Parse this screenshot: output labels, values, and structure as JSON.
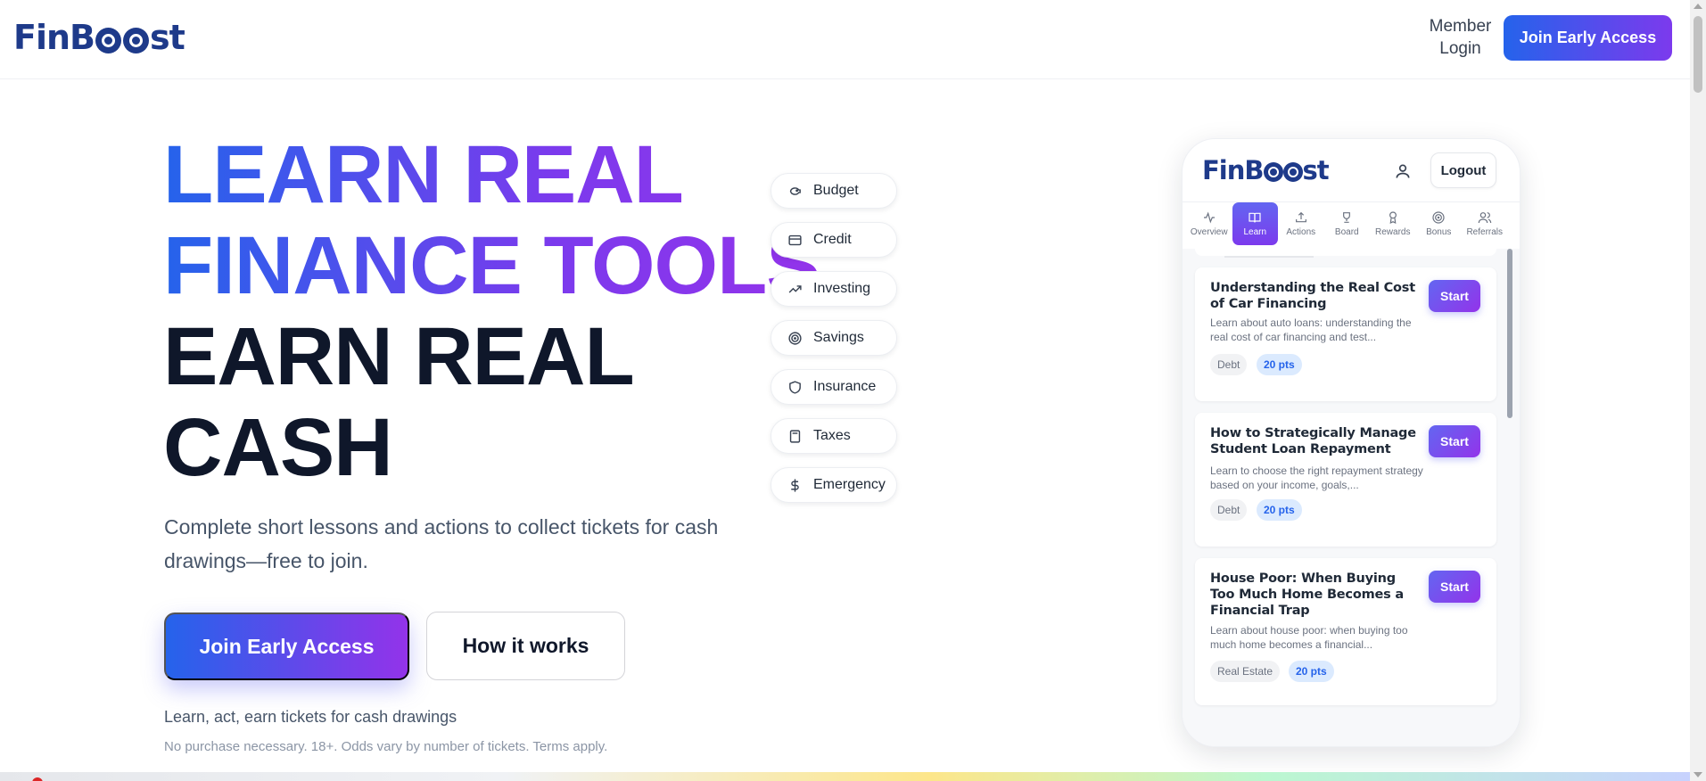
{
  "header": {
    "logo_text": "FinBoost",
    "member_login": "Member Login",
    "cta": "Join Early Access"
  },
  "hero": {
    "line1": "LEARN REAL",
    "line2": "FINANCE TOOLS",
    "line3": "EARN REAL",
    "line4": "CASH",
    "subtitle": "Complete short lessons and actions to collect tickets for cash drawings—free to join.",
    "primary_button": "Join Early Access",
    "secondary_button": "How it works",
    "note": "Learn, act, earn tickets for cash drawings",
    "fine_print": "No purchase necessary. 18+. Odds vary by number of tickets. Terms apply."
  },
  "categories": [
    {
      "label": "Budget",
      "icon": "piggy-bank-icon"
    },
    {
      "label": "Credit",
      "icon": "credit-card-icon"
    },
    {
      "label": "Investing",
      "icon": "trending-up-icon"
    },
    {
      "label": "Savings",
      "icon": "target-icon"
    },
    {
      "label": "Insurance",
      "icon": "shield-icon"
    },
    {
      "label": "Taxes",
      "icon": "calculator-icon"
    },
    {
      "label": "Emergency",
      "icon": "dollar-icon"
    }
  ],
  "phone": {
    "logo_text": "FinBoost",
    "logout": "Logout",
    "tabs": [
      {
        "label": "Overview",
        "icon": "activity-icon"
      },
      {
        "label": "Learn",
        "icon": "book-icon",
        "active": true
      },
      {
        "label": "Actions",
        "icon": "upload-icon"
      },
      {
        "label": "Board",
        "icon": "trophy-icon"
      },
      {
        "label": "Rewards",
        "icon": "award-icon"
      },
      {
        "label": "Bonus",
        "icon": "target-icon"
      },
      {
        "label": "Referrals",
        "icon": "users-icon"
      }
    ],
    "lessons": [
      {
        "title": "Understanding the Real Cost of Car Financing",
        "description": "Learn about auto loans: understanding the real cost of car financing and test...",
        "category": "Debt",
        "points": "20 pts",
        "button": "Start"
      },
      {
        "title": "How to Strategically Manage Student Loan Repayment",
        "description": "Learn to choose the right repayment strategy based on your income, goals,...",
        "category": "Debt",
        "points": "20 pts",
        "button": "Start"
      },
      {
        "title": "House Poor: When Buying Too Much Home Becomes a Financial Trap",
        "description": "Learn about house poor: when buying too much home becomes a financial...",
        "category": "Real Estate",
        "points": "20 pts",
        "button": "Start"
      }
    ]
  },
  "colors": {
    "brand_navy": "#1e3a8a",
    "gradient_start": "#2563eb",
    "gradient_end": "#9333ea"
  }
}
